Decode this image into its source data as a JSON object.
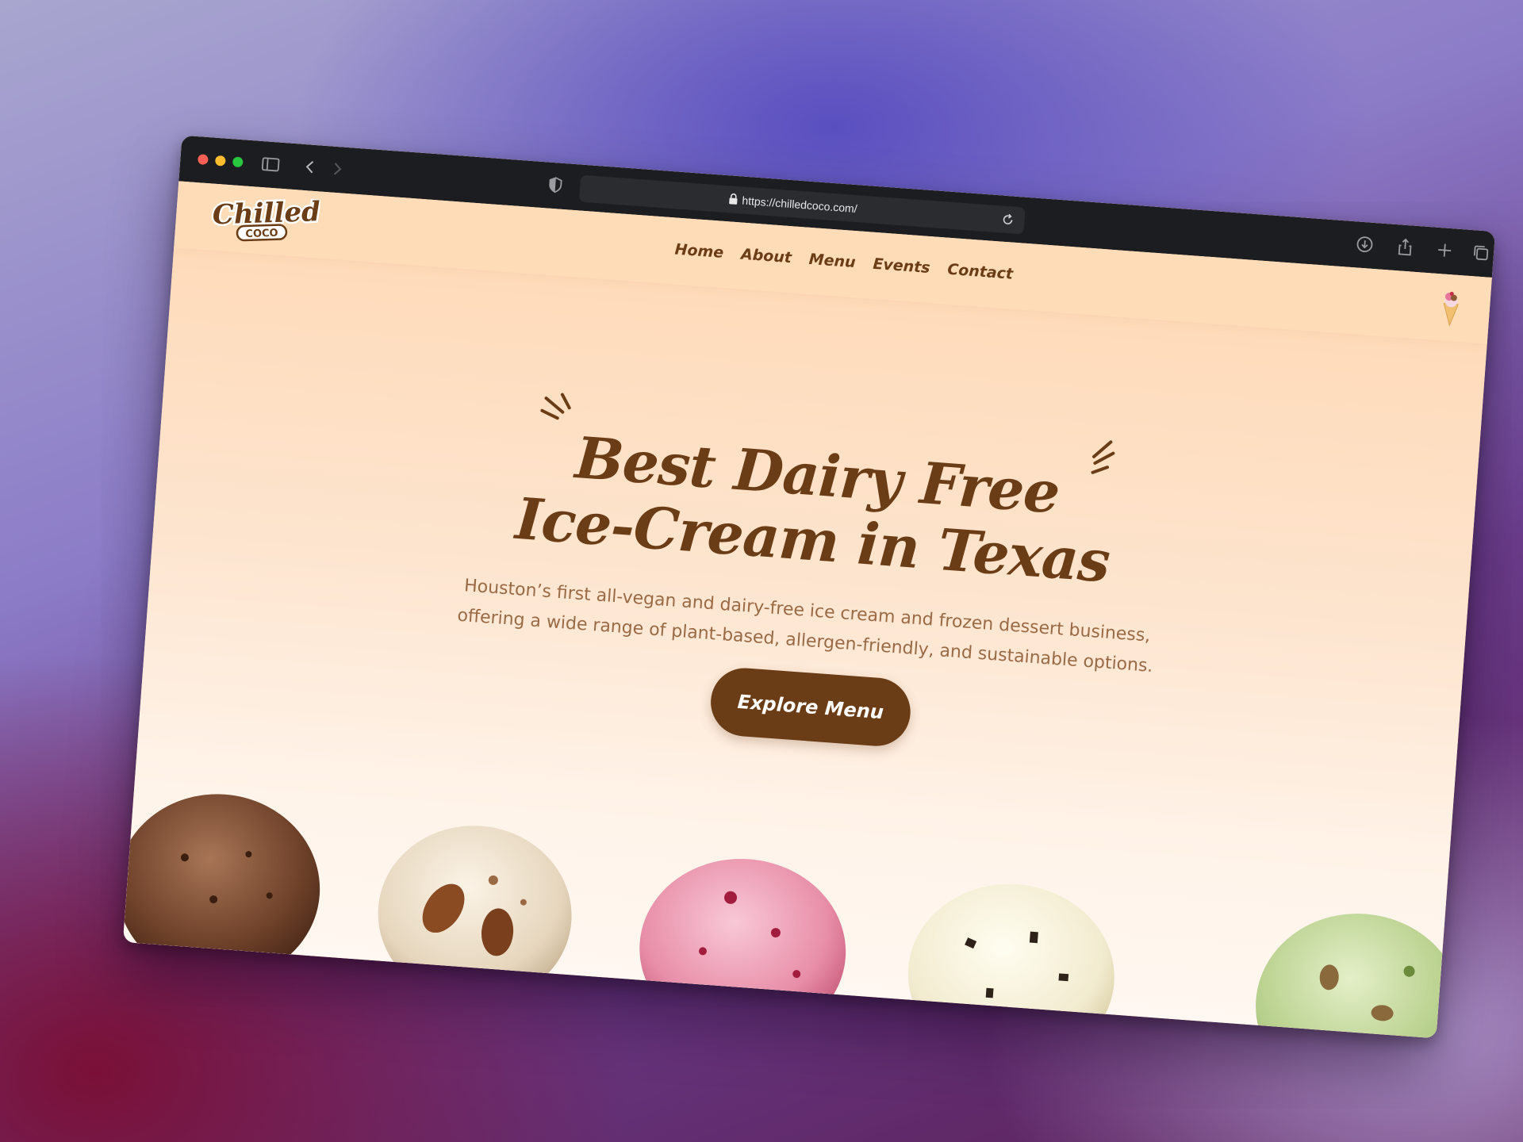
{
  "browser": {
    "url": "https://chilledcoco.com/",
    "icons": [
      "sidebar-icon",
      "back-icon",
      "forward-icon",
      "shield-icon",
      "lock-icon",
      "reload-icon",
      "download-icon",
      "share-icon",
      "new-tab-icon",
      "tabs-overview-icon"
    ]
  },
  "site": {
    "logo_top": "Chilled",
    "logo_bottom": "COCO",
    "nav": [
      "Home",
      "About",
      "Menu",
      "Events",
      "Contact"
    ],
    "hero": {
      "title_line1": "Best Dairy Free",
      "title_line2": "Ice-Cream in Texas",
      "subtitle_line1": "Houston’s first all-vegan and dairy-free ice cream and frozen dessert business,",
      "subtitle_line2": "offering a wide range of plant-based, allergen-friendly, and sustainable options.",
      "cta": "Explore Menu"
    },
    "scoops": [
      "chocolate",
      "butter-pecan",
      "strawberry",
      "cookies-and-cream",
      "pistachio"
    ]
  },
  "colors": {
    "brand_brown": "#6b3d16",
    "nav_bg": "#ffdcb8",
    "chrome_bg": "#1c1d20"
  }
}
